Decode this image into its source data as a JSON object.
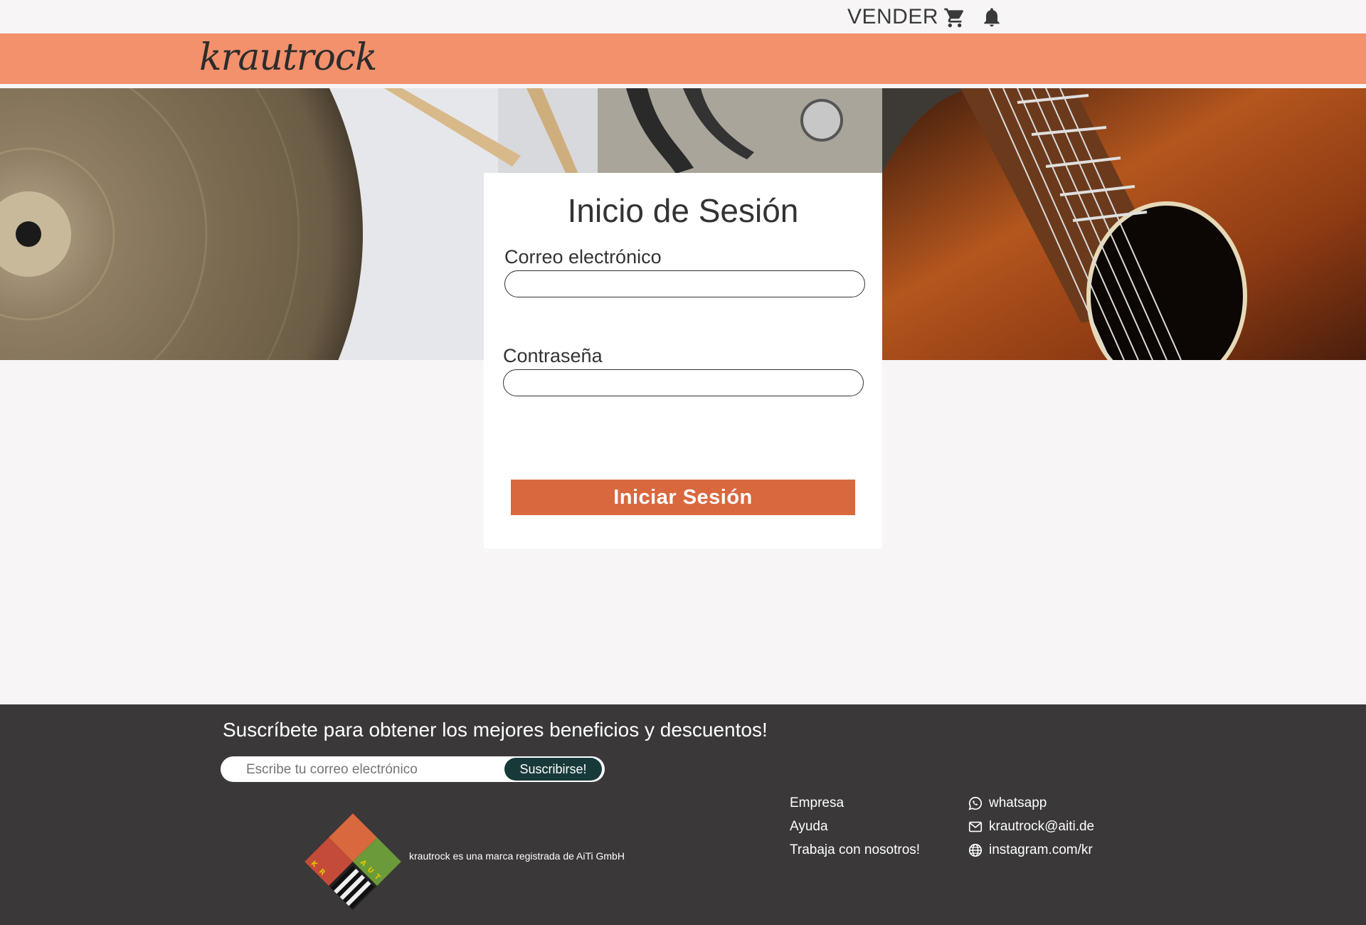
{
  "header": {
    "sell_label": "VENDER",
    "cart_icon": "cart-icon",
    "bell_icon": "bell-icon",
    "brand": "krautrock"
  },
  "login": {
    "title": "Inicio de Sesión",
    "email_label": "Correo electrónico",
    "email_value": "",
    "password_label": "Contraseña",
    "password_value": "",
    "submit_label": "Iniciar Sesión"
  },
  "footer": {
    "subscribe_title": "Suscríbete para obtener los mejores beneficios y descuentos!",
    "subscribe_placeholder": "Escribe tu correo electrónico",
    "subscribe_button": "Suscribirse!",
    "logo_letters": [
      "K",
      "R",
      "A",
      "U",
      "T"
    ],
    "legal": "krautrock es una marca registrada de AiTi GmbH",
    "links": [
      "Empresa",
      "Ayuda",
      "Trabaja con nosotros!"
    ],
    "contacts": [
      {
        "icon": "whatsapp-icon",
        "label": "whatsapp"
      },
      {
        "icon": "mail-icon",
        "label": "krautrock@aiti.de"
      },
      {
        "icon": "globe-icon",
        "label": "instagram.com/kr"
      }
    ]
  },
  "colors": {
    "brand_band": "#f2916c",
    "button": "#d9683f",
    "footer_bg": "#3a3839",
    "subscribe_button": "#17393a"
  }
}
